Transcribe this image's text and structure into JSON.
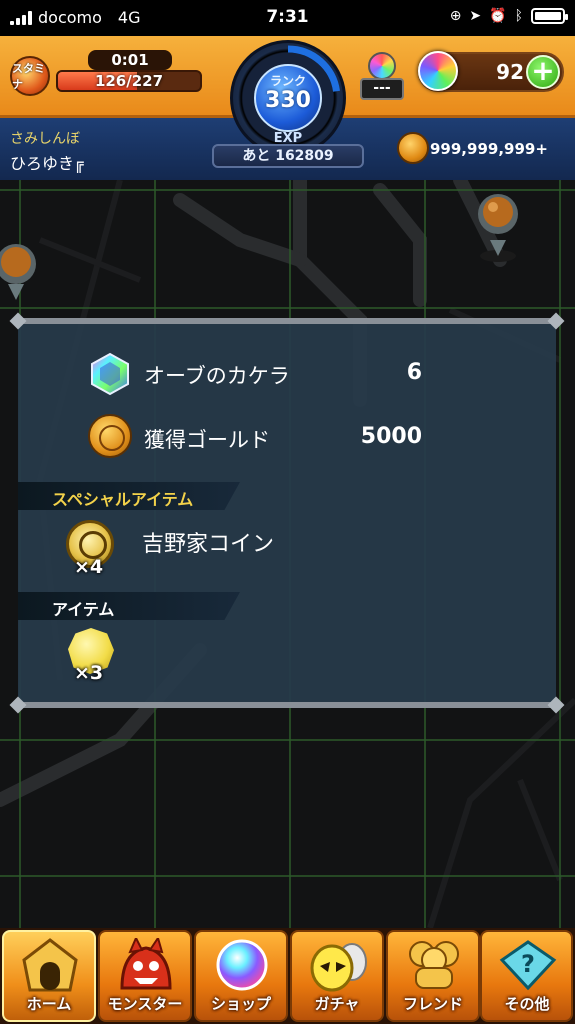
{
  "status_bar": {
    "carrier": "docomo",
    "network": "4G",
    "time": "7:31"
  },
  "header": {
    "stamina_label": "スタミナ",
    "stamina_timer": "0:01",
    "stamina_value": "126/227",
    "stamina_fraction": 0.555,
    "rank_label": "ランク",
    "rank_value": "330",
    "exp_label": "EXP",
    "exp_remaining": "あと 162809",
    "cup_value": "---",
    "orb_count": "92",
    "orb_add_symbol": "+",
    "user_subtitle": "さみしんぼ",
    "user_name": "ひろゆき╔",
    "gold_value": "999,999,999+"
  },
  "result_panel": {
    "rows": [
      {
        "label": "オーブのカケラ",
        "value": "6",
        "icon": "rainbow-gem-icon"
      },
      {
        "label": "獲得ゴールド",
        "value": "5000",
        "icon": "gold-coin-icon"
      }
    ],
    "special_section_title": "スペシャルアイテム",
    "special_item": {
      "name": "吉野家コイン",
      "quantity": "×4",
      "icon": "medal-icon"
    },
    "item_section_title": "アイテム",
    "item": {
      "quantity": "×3",
      "icon": "gold-nugget-icon"
    }
  },
  "bottom_nav": {
    "items": [
      {
        "label": "ホーム",
        "icon": "home-icon"
      },
      {
        "label": "モンスター",
        "icon": "monster-icon"
      },
      {
        "label": "ショップ",
        "icon": "shop-orb-icon"
      },
      {
        "label": "ガチャ",
        "icon": "gacha-egg-icon"
      },
      {
        "label": "フレンド",
        "icon": "friend-icon"
      },
      {
        "label": "その他",
        "icon": "other-icon"
      }
    ]
  },
  "colors": {
    "header_orange": "#e98a1a",
    "panel_bg": "#273a4a",
    "accent_gold": "#f3d24a",
    "map_grid": "#2c5a2a"
  }
}
